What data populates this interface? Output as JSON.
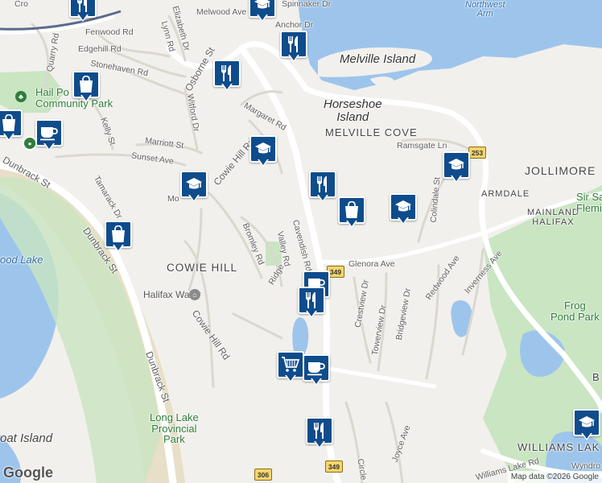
{
  "map": {
    "water_labels": {
      "northwest_arm": "Northwest\nArm",
      "long_lake": "ood Lake"
    },
    "islands": {
      "melville": "Melville Island",
      "horseshoe": "Horseshoe\nIsland",
      "oat": "oat Island"
    },
    "areas": {
      "melville_cove": "MELVILLE COVE",
      "jollimore": "JOLLIMORE",
      "armdale": "ARMDALE",
      "mainland_halifax": "MAINLAND\nHALIFAX",
      "cowie_hill": "COWIE HILL",
      "williams_lake": "WILLIAMS LAK",
      "b": "B"
    },
    "parks": {
      "hail_pond": "Hail Po\nCommunity Park",
      "long_lake_park": "Long Lake\nProvincial\nPark",
      "frog_pond": "Frog\nPond Park",
      "sir_sandford": "Sir Sa\nFlemi"
    },
    "pois": {
      "halifax_water": "Halifax Water"
    },
    "roads": {
      "melwood": "Melwood Ave",
      "fenwood": "Fenwood Rd",
      "edgehill": "Edgehill Rd",
      "stonehaven": "Stonehaven Rd",
      "quarry": "Quarry Rd",
      "elizabeth": "Elizabeth Dr",
      "lynn": "Lynn Rd",
      "osborne": "Osborne St",
      "witford": "Witford Dr",
      "kelly": "Kelly St",
      "marriott": "Marriott St",
      "sunset": "Sunset Ave",
      "margaret": "Margaret Rd",
      "spinnaker": "Spinnaker Dr",
      "anchor": "Anchor Dr",
      "ramsgate": "Ramsgate Ln",
      "cowie_hill_rd_top": "Cowie Hill Rd",
      "cowie_hill_rd": "Cowie Hill Rd",
      "cavendish": "Cavendish Rd",
      "bromley": "Bromley Rd",
      "valley": "Valley Rd",
      "ridge": "Ridge",
      "glenora": "Glenora Ave",
      "crestview": "Crestview Dr",
      "towerview": "Towerview Dr",
      "bridgeview": "Bridgeview Dr",
      "colindale": "Colindale St",
      "redwood": "Redwood Ave",
      "inverness": "Inverness Ave",
      "dunbrack_top": "Dunbrack St",
      "dunbrack_mid": "Dunbrack St",
      "dunbrack_bot": "Dunbrack St",
      "tamarack": "Tamarack Dr",
      "joyce": "Joyce Ave",
      "circle": "Circle",
      "williams_lake_rd": "Williams Lake Rd",
      "wyndrock": "Wyndro",
      "mo": "Mo",
      "cro": "Cro"
    },
    "route_shields": [
      "253",
      "349",
      "349",
      "306"
    ],
    "markers": [
      {
        "icon": "restaurant-icon"
      },
      {
        "icon": "school-icon"
      },
      {
        "icon": "restaurant-icon"
      },
      {
        "icon": "shopping-icon"
      },
      {
        "icon": "restaurant-icon"
      },
      {
        "icon": "cafe-icon"
      },
      {
        "icon": "shopping-icon"
      },
      {
        "icon": "school-icon"
      },
      {
        "icon": "school-icon"
      },
      {
        "icon": "restaurant-icon"
      },
      {
        "icon": "shopping-icon"
      },
      {
        "icon": "school-icon"
      },
      {
        "icon": "school-icon"
      },
      {
        "icon": "shopping-icon"
      },
      {
        "icon": "cafe-icon"
      },
      {
        "icon": "restaurant-icon"
      },
      {
        "icon": "grocery-icon"
      },
      {
        "icon": "cafe-icon"
      },
      {
        "icon": "restaurant-icon"
      },
      {
        "icon": "school-icon"
      }
    ],
    "branding": "Google",
    "attribution": "Map data ©2026 Google"
  },
  "colors": {
    "land": "#f2f0ec",
    "water": "#9dc5ec",
    "park": "#c9e5c2",
    "marker": "#0f4c8c",
    "highway": "#f7d56b"
  }
}
